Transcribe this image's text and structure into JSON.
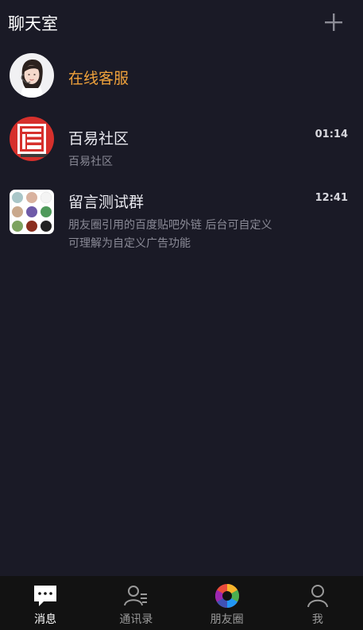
{
  "header": {
    "title": "聊天室",
    "add_icon": "plus-icon"
  },
  "conversations": [
    {
      "name": "在线客服",
      "time": "",
      "preview": "",
      "avatar_icon": "support-agent-avatar",
      "accent": "#f0a23b"
    },
    {
      "name": "百易社区",
      "time": "01:14",
      "preview": "百易社区",
      "avatar_icon": "community-logo-avatar"
    },
    {
      "name": "留言测试群",
      "time": "12:41",
      "preview_line1": "朋友圈引用的百度贴吧外链 后台可自定义",
      "preview_line2": "可理解为自定义广告功能",
      "avatar_icon": "group-grid-avatar"
    }
  ],
  "tabbar": {
    "items": [
      {
        "label": "消息",
        "icon": "chat-bubble-icon",
        "active": true
      },
      {
        "label": "通讯录",
        "icon": "contacts-icon",
        "active": false
      },
      {
        "label": "朋友圈",
        "icon": "moments-aperture-icon",
        "active": false
      },
      {
        "label": "我",
        "icon": "person-icon",
        "active": false
      }
    ]
  },
  "colors": {
    "background": "#1a1a26",
    "tabbar": "#121212",
    "accent": "#f0a23b"
  }
}
